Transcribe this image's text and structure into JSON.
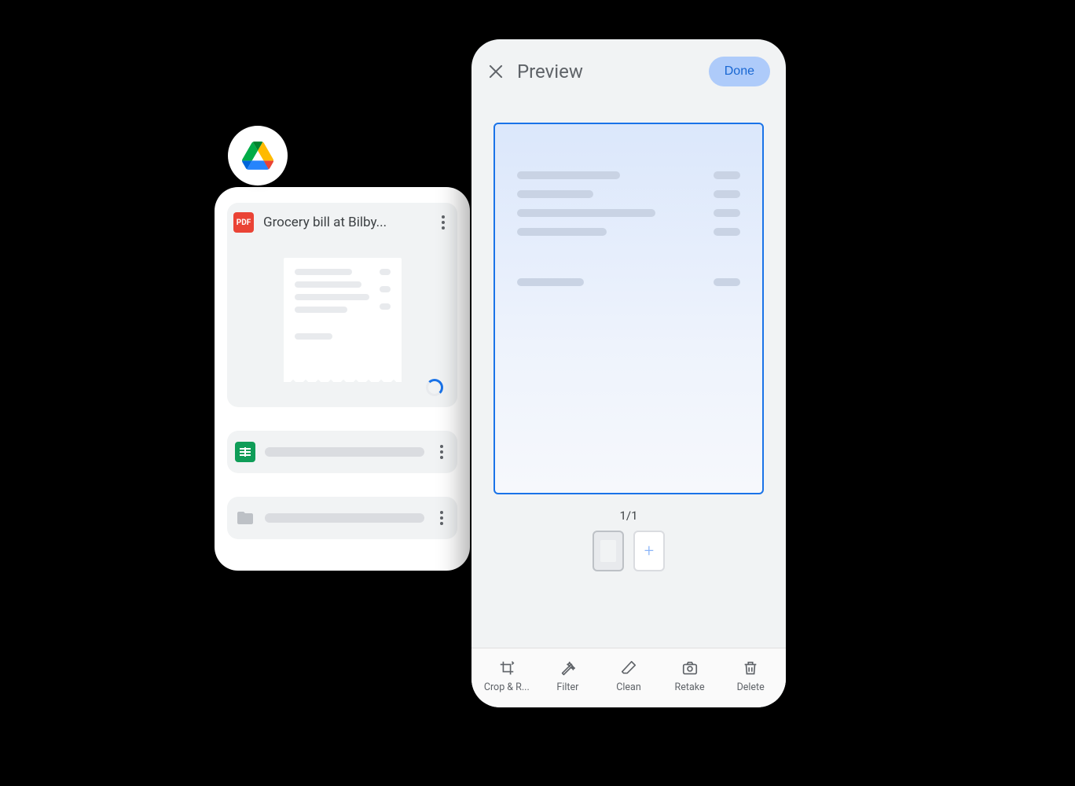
{
  "drive": {
    "files": [
      {
        "type": "pdf",
        "title": "Grocery bill at Bilby...",
        "icon_label": "PDF"
      },
      {
        "type": "sheets",
        "title": ""
      },
      {
        "type": "folder",
        "title": ""
      }
    ]
  },
  "preview": {
    "title": "Preview",
    "done_label": "Done",
    "page_counter": "1/1",
    "toolbar": [
      {
        "id": "crop",
        "label": "Crop & R..."
      },
      {
        "id": "filter",
        "label": "Filter"
      },
      {
        "id": "clean",
        "label": "Clean"
      },
      {
        "id": "retake",
        "label": "Retake"
      },
      {
        "id": "delete",
        "label": "Delete"
      }
    ]
  }
}
